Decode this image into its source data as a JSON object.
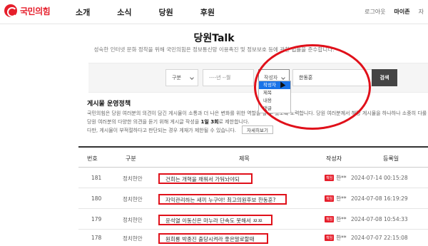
{
  "header": {
    "logo_text": "국민의힘",
    "nav": [
      "소개",
      "소식",
      "당원",
      "후원"
    ],
    "util": [
      "로그아웃",
      "마이존",
      "자"
    ]
  },
  "page": {
    "title": "당원Talk",
    "description": "성숙한 인터넷 문화 정착을 위해 국민의힘은 정보통신망 이용촉진 및 정보보호 등에 관한 법률을 준수합니다."
  },
  "search": {
    "category": "구분",
    "date": "----년 --월",
    "field": "작성자",
    "query": "한동훈",
    "button": "검색",
    "field_options": [
      "작성자",
      "제목",
      "내용",
      "댓글"
    ],
    "selected_option": "작성자"
  },
  "policy": {
    "title": "게시물 운영정책",
    "line1": "국민의힘은 당원 여러분의 의견이 담긴 게시물이 소통과 더 나은 변화를 위한 역할을 할 수 있도록 노력합니다. 당원 여러분께서 해당 게시물을 하나하나 소중히 다룰 것입니다.",
    "line2_pre": "당원 여러분의 다양한 의견을 듣기 위해 게시글 작성을 ",
    "line2_bold": "1일 3회",
    "line2_post": "로 제한합니다.",
    "line3": "다만, 게시물이 부적절하다고 판단되는 경우 게재가 제한될 수 있습니다.",
    "detail_button": "자세히보기"
  },
  "table": {
    "headers": [
      "번호",
      "구분",
      "제목",
      "작성자",
      "등록일"
    ],
    "rows": [
      {
        "num": "181",
        "category": "정치현안",
        "title": "건희는 개혁을 채워서 가둬놔야되",
        "badge": "책임",
        "author": "한**",
        "date": "2024-07-14 00:15:28"
      },
      {
        "num": "180",
        "category": "정치현안",
        "title": "자익관리하는 새끼 누구야! 최고의원후보 한동훈?",
        "badge": "책임",
        "author": "한**",
        "date": "2024-07-08 16:19:29"
      },
      {
        "num": "179",
        "category": "정치현안",
        "title": "윤석열 이동신은 마누라 단속도 못해서 ㅉㅉ",
        "badge": "책임",
        "author": "한**",
        "date": "2024-07-08 10:54:33"
      },
      {
        "num": "178",
        "category": "정치현안",
        "title": "원희룡 박종진 출당시켜라 좋은말로할때",
        "badge": "책임",
        "author": "한**",
        "date": "2024-07-07 22:15:08"
      }
    ]
  }
}
